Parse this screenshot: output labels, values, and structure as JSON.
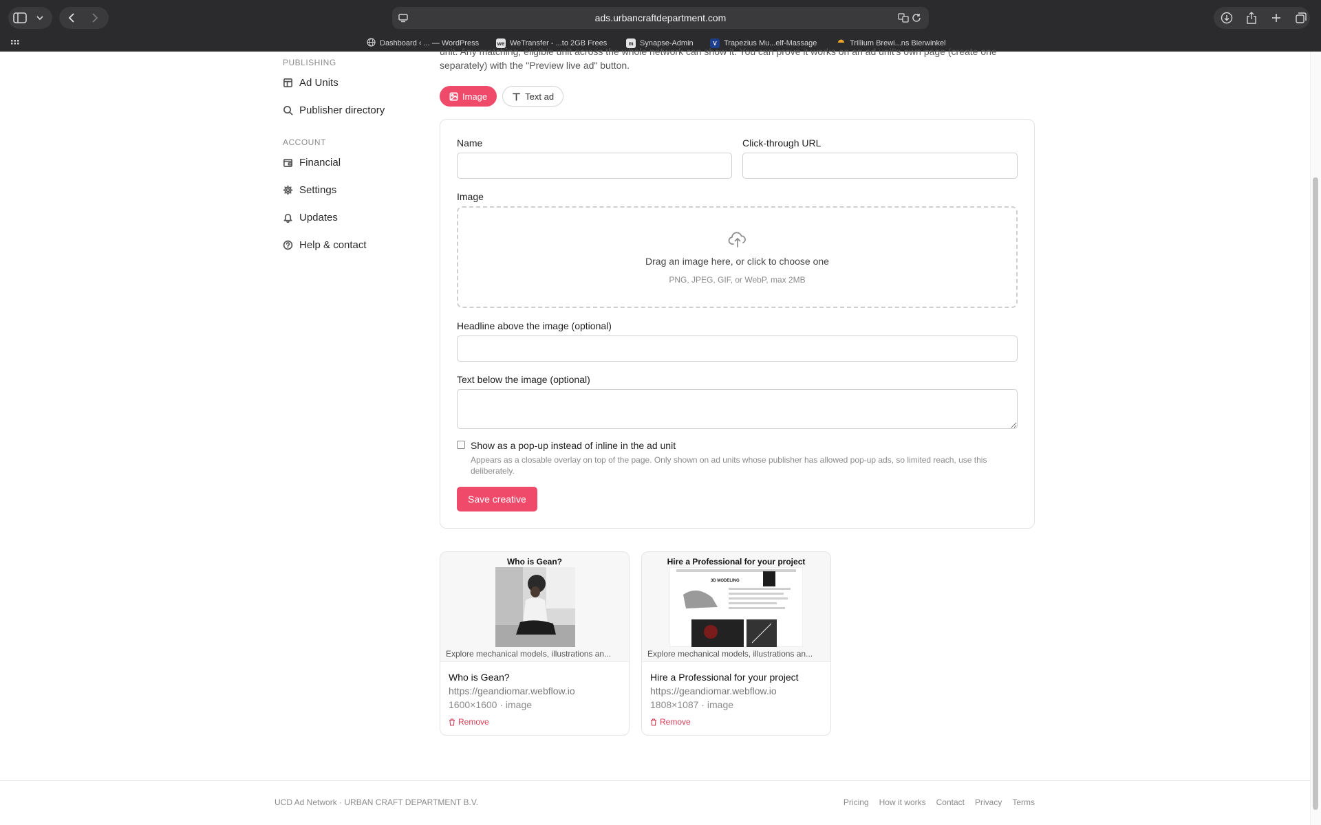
{
  "browser": {
    "url": "ads.urbancraftdepartment.com",
    "bookmarks": [
      {
        "label": "Dashboard ‹ ... — WordPress",
        "icon": "globe-icon"
      },
      {
        "label": "WeTransfer - ...to 2GB Frees",
        "icon": "we"
      },
      {
        "label": "Synapse-Admin",
        "icon": "m"
      },
      {
        "label": "Trapezius Mu...elf-Massage",
        "icon": "V"
      },
      {
        "label": "Trillium Brewi...ns Bierwinkel",
        "icon": "sun-icon"
      }
    ]
  },
  "sidebar": {
    "publishing_heading": "PUBLISHING",
    "publishing_items": [
      {
        "label": "Ad Units",
        "icon": "ad-units-icon"
      },
      {
        "label": "Publisher directory",
        "icon": "search-icon"
      }
    ],
    "account_heading": "ACCOUNT",
    "account_items": [
      {
        "label": "Financial",
        "icon": "wallet-icon"
      },
      {
        "label": "Settings",
        "icon": "gear-icon"
      },
      {
        "label": "Updates",
        "icon": "bell-icon"
      },
      {
        "label": "Help & contact",
        "icon": "help-icon"
      }
    ]
  },
  "main": {
    "intro_text": "unit. Any matching, eligible unit across the whole network can show it. You can prove it works on an ad unit's own page (create one separately) with the \"Preview live ad\" button.",
    "tabs": [
      {
        "label": "Image",
        "active": true
      },
      {
        "label": "Text ad",
        "active": false
      }
    ],
    "form": {
      "name_label": "Name",
      "name_value": "",
      "url_label": "Click-through URL",
      "url_value": "",
      "image_label": "Image",
      "dropzone_title": "Drag an image here, or click to choose one",
      "dropzone_sub": "PNG, JPEG, GIF, or WebP, max 2MB",
      "headline_label": "Headline above the image (optional)",
      "headline_value": "",
      "text_label": "Text below the image (optional)",
      "text_value": "",
      "popup_label": "Show as a pop-up instead of inline in the ad unit",
      "popup_checked": false,
      "popup_help": "Appears as a closable overlay on top of the page. Only shown on ad units whose publisher has allowed pop-up ads, so limited reach, use this deliberately.",
      "save_label": "Save creative"
    },
    "creatives": [
      {
        "preview_headline": "Who is Gean?",
        "preview_text": "Explore mechanical models, illustrations an...",
        "title": "Who is Gean?",
        "url": "https://geandiomar.webflow.io",
        "meta": "1600×1600 · image",
        "remove_label": "Remove"
      },
      {
        "preview_headline": "Hire a Professional for your project",
        "preview_text": "Explore mechanical models, illustrations an...",
        "preview_image_heading": "3D MODELING",
        "title": "Hire a Professional for your project",
        "url": "https://geandiomar.webflow.io",
        "meta": "1808×1087 · image",
        "remove_label": "Remove"
      }
    ]
  },
  "footer": {
    "left": "UCD Ad Network · URBAN CRAFT DEPARTMENT B.V.",
    "links": [
      "Pricing",
      "How it works",
      "Contact",
      "Privacy",
      "Terms"
    ]
  },
  "colors": {
    "accent": "#f04a6b",
    "danger": "#d63a54",
    "chrome": "#2b2b2d"
  }
}
